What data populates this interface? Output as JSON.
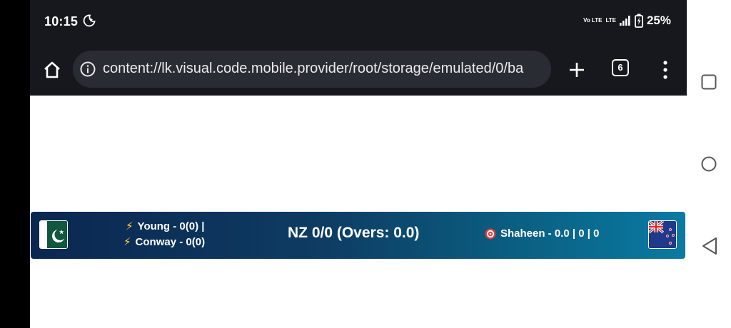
{
  "statusbar": {
    "time": "10:15",
    "net_top": "Vo LTE",
    "net_bottom": "LTE",
    "battery_pct": "25%",
    "icons": [
      "moon-icon",
      "signal-icon",
      "battery-icon"
    ]
  },
  "browser": {
    "url": "content://lk.visual.code.mobile.provider/root/storage/emulated/0/ba",
    "tab_count": "6",
    "icons": [
      "home-icon",
      "info-icon",
      "plus-icon",
      "tabs-icon",
      "more-vert-icon"
    ]
  },
  "scorebar": {
    "batter1": "Young - 0(0) |",
    "batter2": "Conway - 0(0)",
    "batter_icon": "⚡",
    "score": "NZ 0/0 (Overs: 0.0)",
    "bowler": "Shaheen - 0.0 | 0 | 0",
    "bowler_icon": "target-icon",
    "left_flag": "pakistan-flag",
    "right_flag": "new-zealand-flag",
    "colors": {
      "gradient_start": "#0b2750",
      "gradient_end": "#0b7aa3"
    }
  },
  "navbar": {
    "buttons": [
      "recents-button",
      "home-button",
      "back-button"
    ]
  }
}
